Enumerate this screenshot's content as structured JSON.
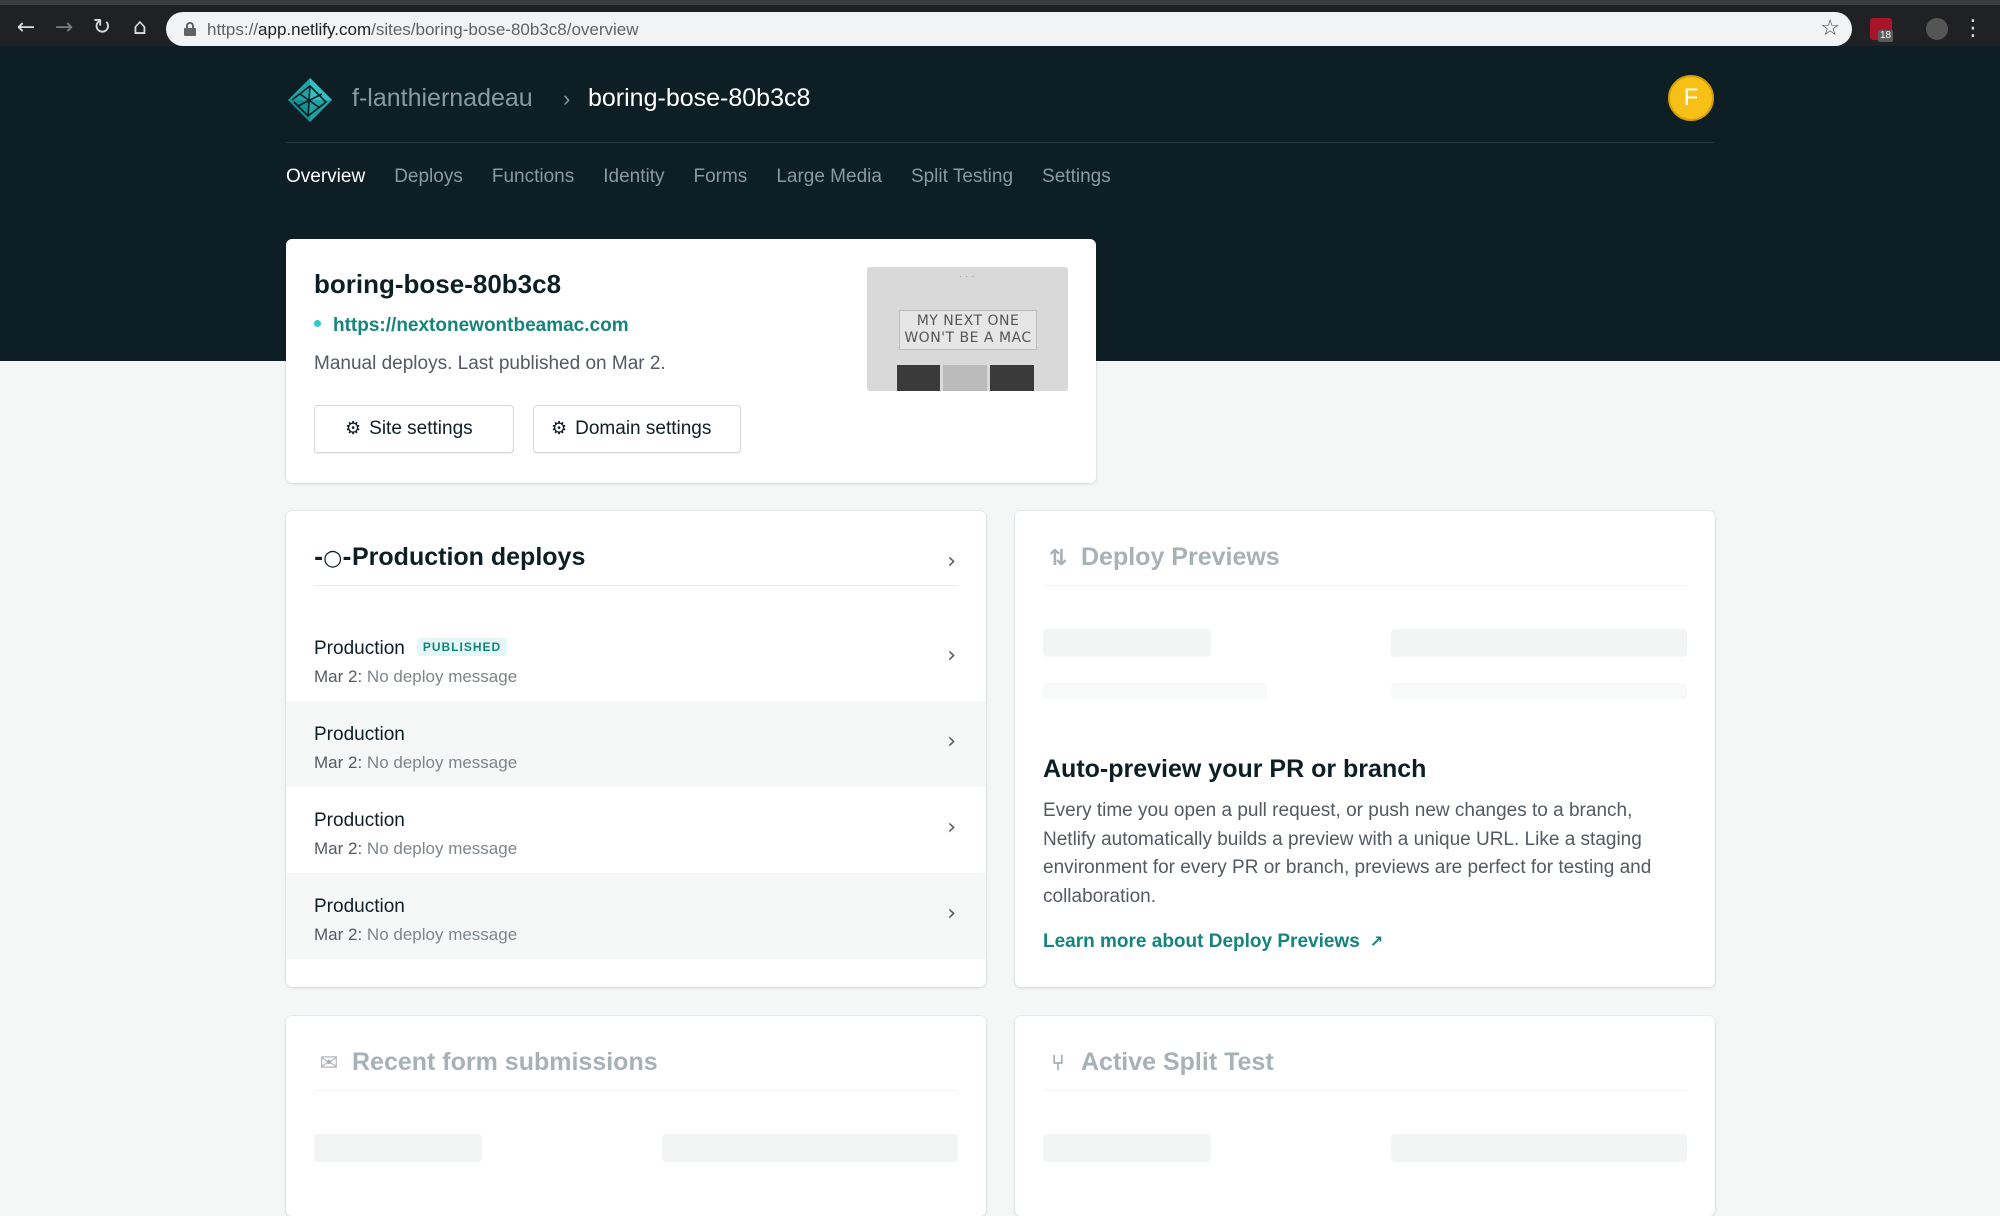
{
  "browser": {
    "url_prefix": "https://",
    "url_host": "app.netlify.com",
    "url_path": "/sites/boring-bose-80b3c8/overview",
    "ext_badge": "18",
    "icons": {
      "back": "back-arrow-icon",
      "forward": "forward-arrow-icon",
      "reload": "reload-icon",
      "home": "home-icon",
      "lock": "lock-icon",
      "star": "star-icon",
      "menu": "kebab-menu-icon"
    }
  },
  "header": {
    "team": "f-lanthiernadeau",
    "separator": "›",
    "site": "boring-bose-80b3c8",
    "user_initial": "F",
    "tabs": [
      "Overview",
      "Deploys",
      "Functions",
      "Identity",
      "Forms",
      "Large Media",
      "Split Testing",
      "Settings"
    ],
    "active_tab": "Overview"
  },
  "site_card": {
    "name": "boring-bose-80b3c8",
    "url": "https://nextonewontbeamac.com",
    "meta": "Manual deploys. Last published on Mar 2.",
    "site_settings_label": "Site settings",
    "domain_settings_label": "Domain settings",
    "thumbnail_text_line1": "MY NEXT ONE",
    "thumbnail_text_line2": "WON'T BE A MAC"
  },
  "production_deploys": {
    "title": "Production deploys",
    "rows": [
      {
        "title": "Production",
        "badge": "PUBLISHED",
        "date": "Mar 2:",
        "message": "No deploy message"
      },
      {
        "title": "Production",
        "badge": "",
        "date": "Mar 2:",
        "message": "No deploy message"
      },
      {
        "title": "Production",
        "badge": "",
        "date": "Mar 2:",
        "message": "No deploy message"
      },
      {
        "title": "Production",
        "badge": "",
        "date": "Mar 2:",
        "message": "No deploy message"
      }
    ]
  },
  "deploy_previews": {
    "title": "Deploy Previews",
    "heading": "Auto-preview your PR or branch",
    "body": "Every time you open a pull request, or push new changes to a branch, Netlify automatically builds a preview with a unique URL. Like a staging environment for every PR or branch, previews are perfect for testing and collaboration.",
    "link": "Learn more about Deploy Previews",
    "link_arrow": "↗"
  },
  "form_submissions": {
    "title": "Recent form submissions"
  },
  "split_test": {
    "title": "Active Split Test"
  },
  "colors": {
    "header_bg": "#0e1e25",
    "accent_teal": "#15847d",
    "avatar_yellow": "#f6c017",
    "page_bg": "#f5f7f7"
  }
}
